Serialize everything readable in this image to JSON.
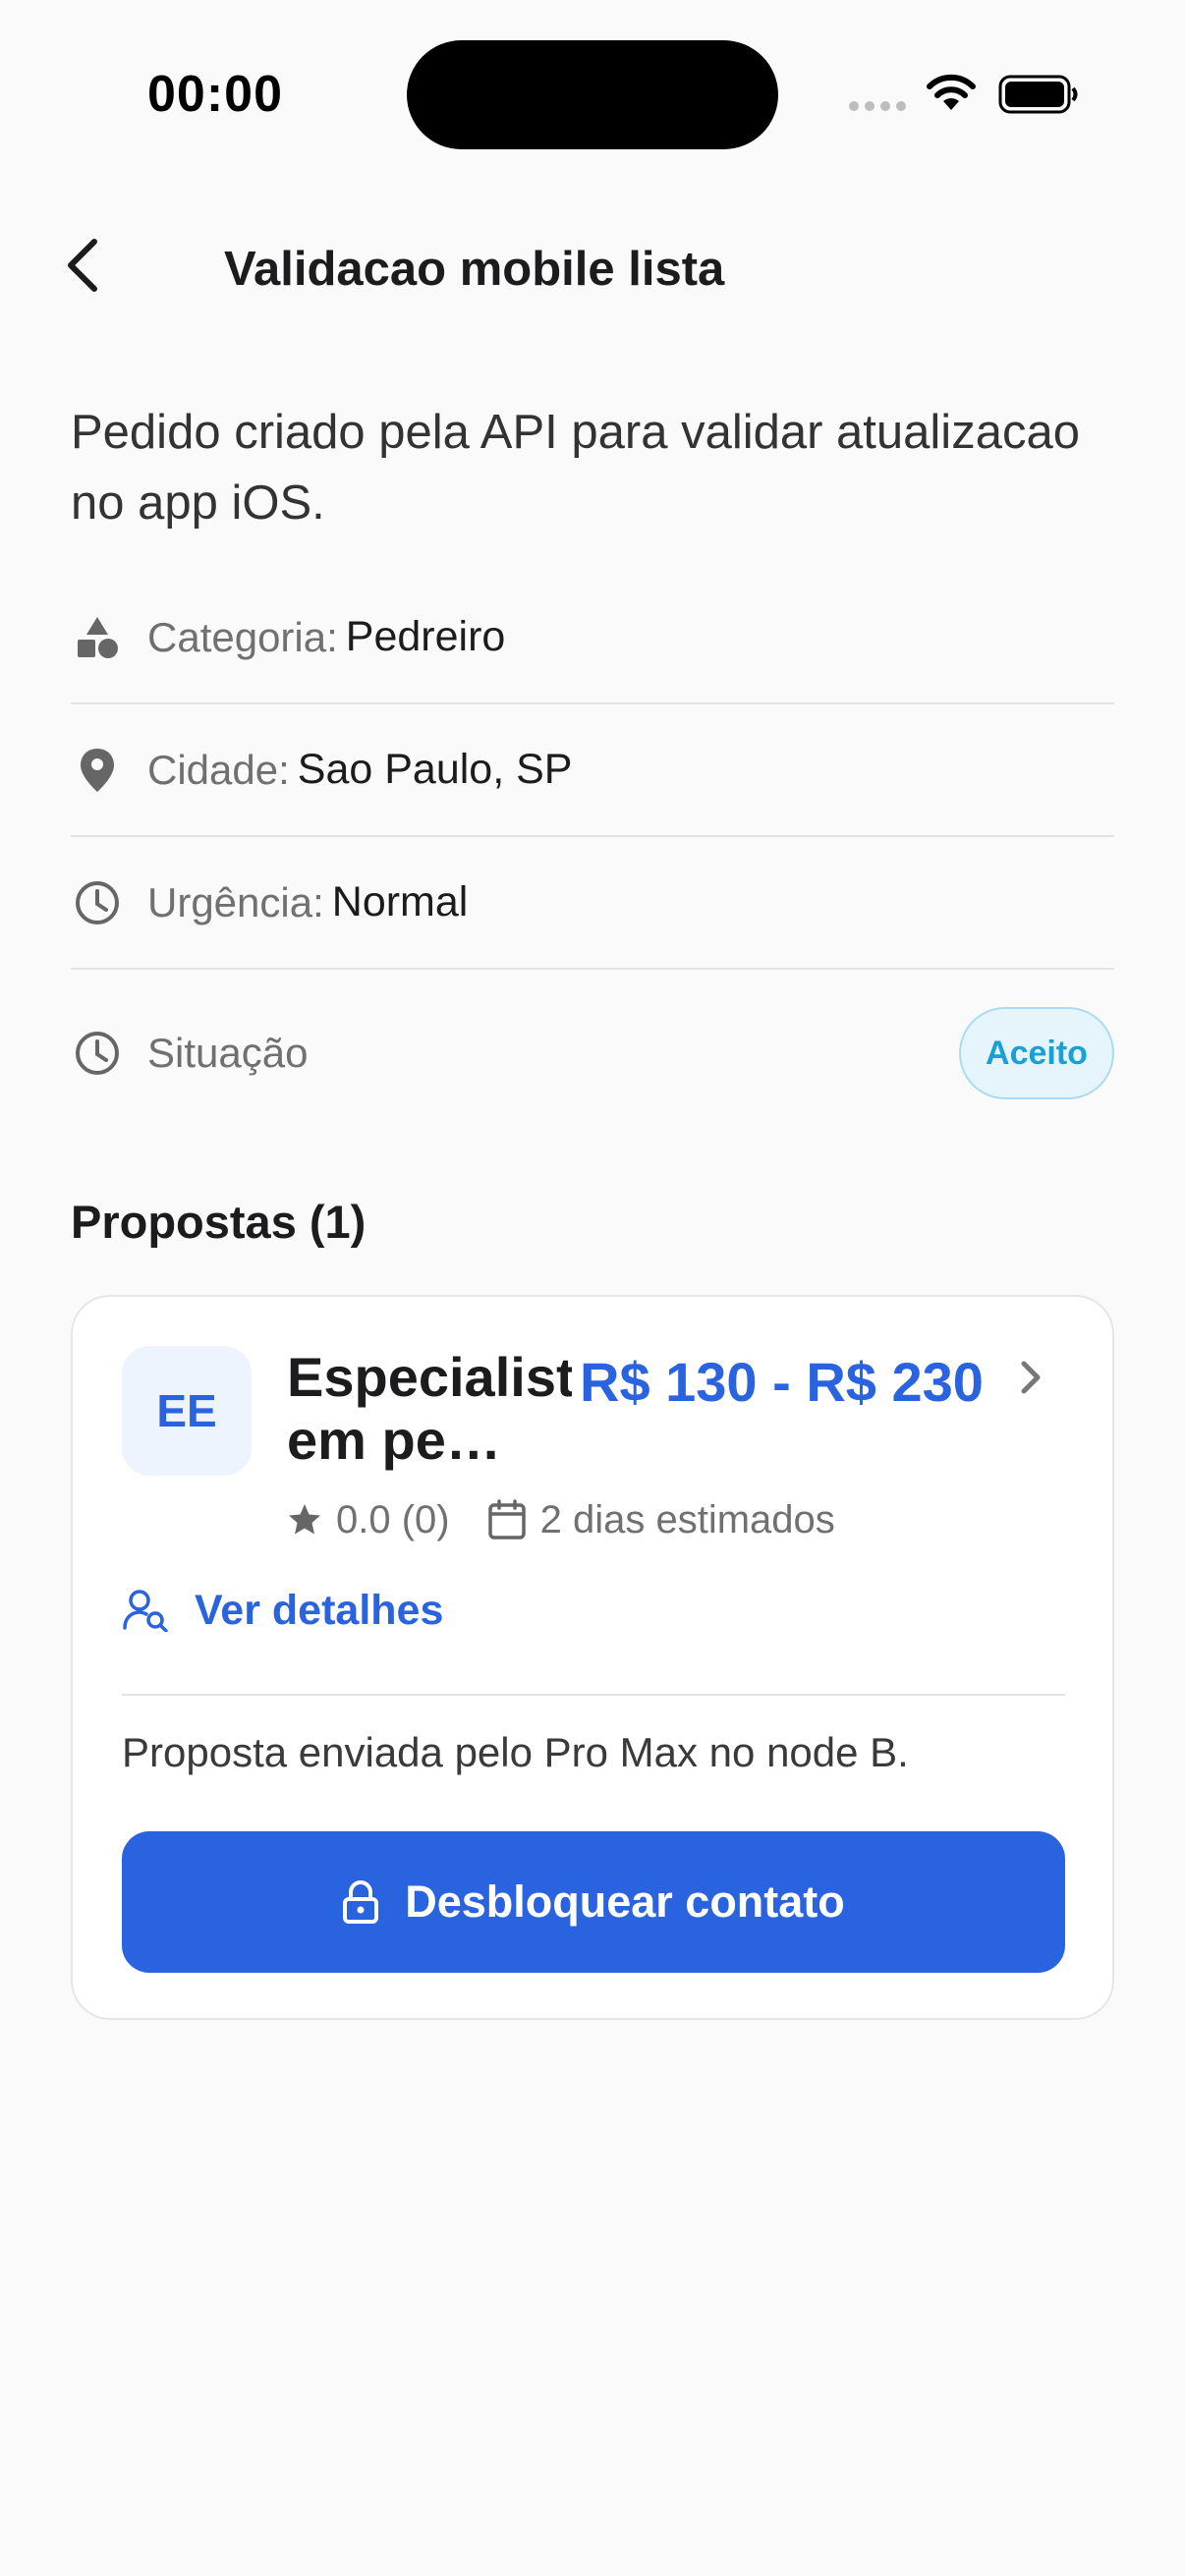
{
  "status_bar": {
    "time": "00:00"
  },
  "nav": {
    "title": "Validacao mobile lista"
  },
  "description": "Pedido criado pela API para validar atualizacao no app iOS.",
  "info": {
    "category": {
      "label": "Categoria:",
      "value": "Pedreiro",
      "icon": "shapes-icon"
    },
    "city": {
      "label": "Cidade:",
      "value": "Sao Paulo, SP",
      "icon": "location-pin-icon"
    },
    "urgency": {
      "label": "Urgência:",
      "value": "Normal",
      "icon": "clock-icon"
    },
    "status": {
      "label": "Situação",
      "badge": "Aceito",
      "icon": "clock-icon"
    }
  },
  "proposals": {
    "title": "Propostas (1)",
    "items": [
      {
        "avatar_initials": "EE",
        "name": "Especialista em pe…",
        "price": "R$ 130 - R$ 230",
        "rating": "0.0 (0)",
        "duration": "2 dias estimados",
        "details_label": "Ver detalhes",
        "message": "Proposta enviada pelo Pro Max no node B.",
        "unlock_label": "Desbloquear contato"
      }
    ]
  },
  "colors": {
    "accent": "#2A63E0",
    "badge_text": "#1A9FD6",
    "badge_bg": "#E6F5FC",
    "background": "#FAFAFA"
  }
}
